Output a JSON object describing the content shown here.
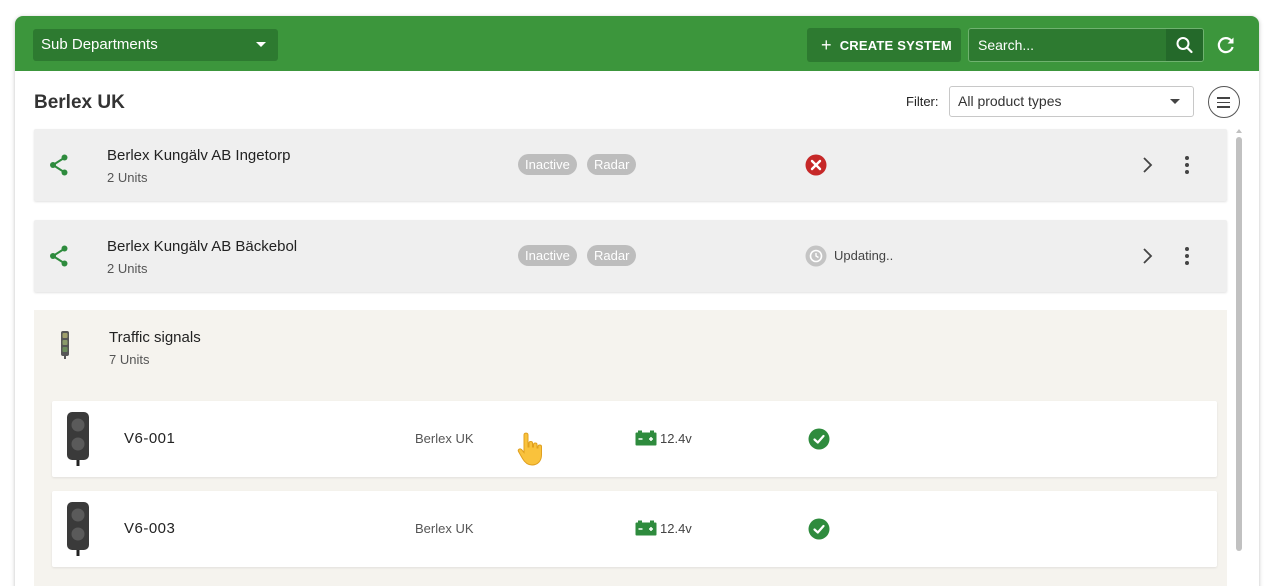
{
  "header": {
    "sub_departments_label": "Sub Departments",
    "create_system_label": "CREATE SYSTEM",
    "search_placeholder": "Search..."
  },
  "page": {
    "title": "Berlex UK",
    "filter_label": "Filter:",
    "filter_value": "All product types"
  },
  "systems": [
    {
      "name": "Berlex Kungälv AB Ingetorp",
      "units": "2 Units",
      "badges": [
        "Inactive",
        "Radar"
      ],
      "status": "error",
      "status_text": ""
    },
    {
      "name": "Berlex Kungälv AB Bäckebol",
      "units": "2 Units",
      "badges": [
        "Inactive",
        "Radar"
      ],
      "status": "updating",
      "status_text": "Updating.."
    }
  ],
  "group": {
    "name": "Traffic signals",
    "units": "7 Units",
    "items": [
      {
        "name": "V6-001",
        "org": "Berlex UK",
        "voltage": "12.4v",
        "status": "ok"
      },
      {
        "name": "V6-003",
        "org": "Berlex UK",
        "voltage": "12.4v",
        "status": "ok"
      }
    ]
  },
  "icons": {
    "system": "share-network-icon",
    "group": "traffic-signal-icon",
    "battery": "battery-icon",
    "ok": "check-circle-icon",
    "error": "error-circle-icon",
    "updating": "clock-icon"
  },
  "colors": {
    "header_green": "#3c963c",
    "dark_green": "#2d7a30",
    "error_red": "#c62828",
    "ok_green": "#2e8b3d",
    "badge_grey": "#bdbdbd"
  }
}
